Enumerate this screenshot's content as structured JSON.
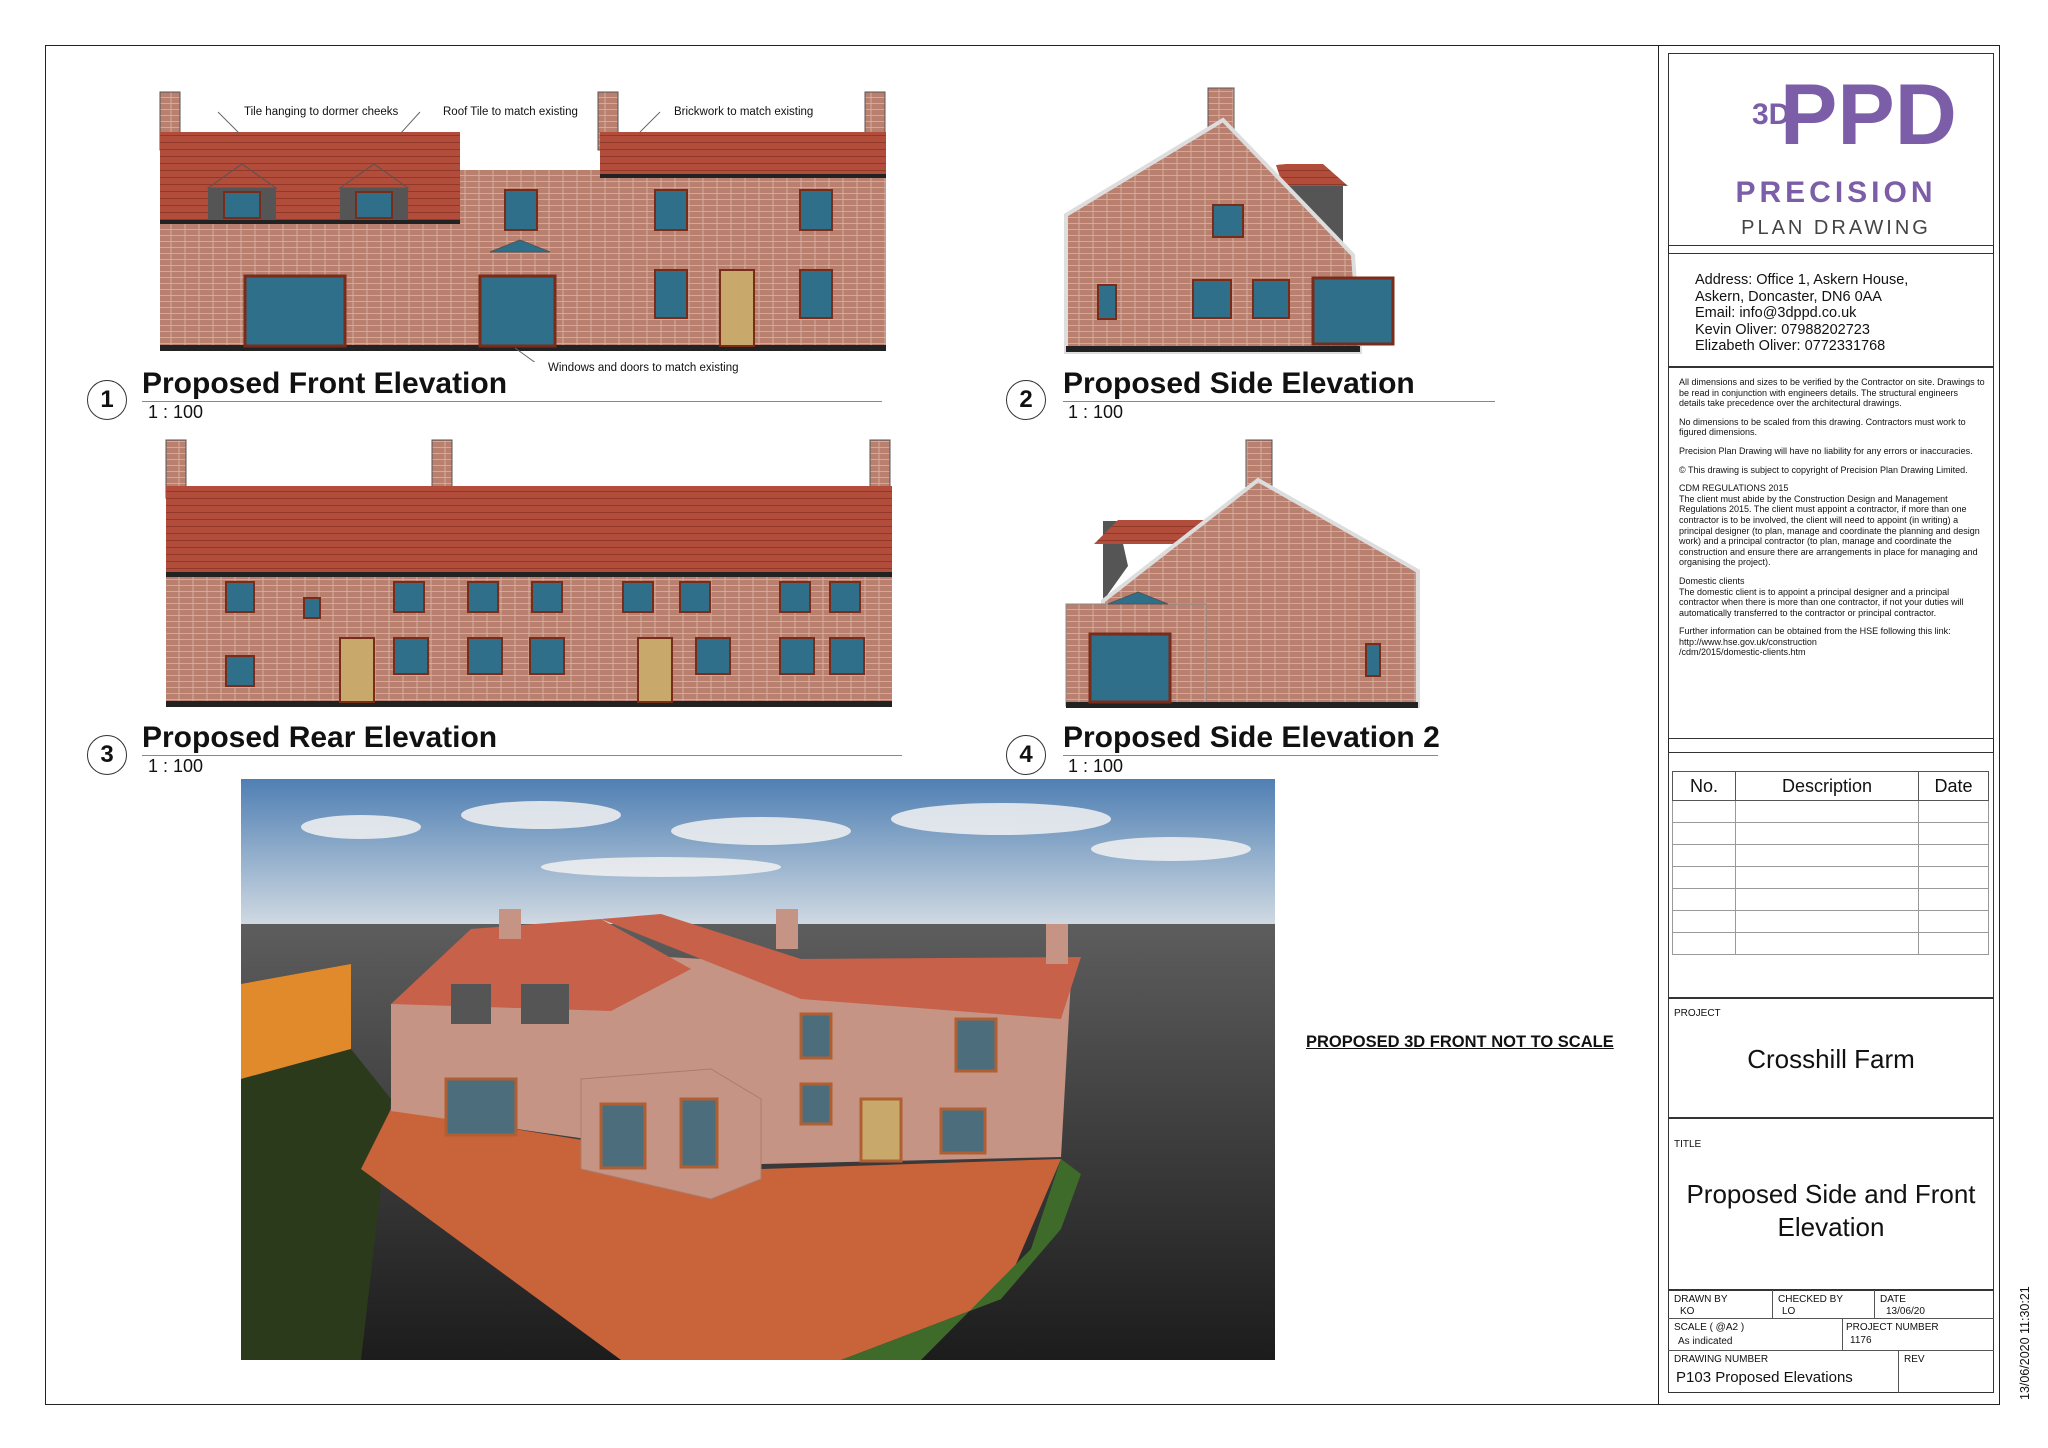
{
  "annotations": {
    "tile_hanging": "Tile hanging to dormer cheeks",
    "roof_tile": "Roof Tile to match existing",
    "brickwork": "Brickwork to match existing",
    "windows_doors": "Windows and doors to match existing"
  },
  "views": [
    {
      "number": "1",
      "title": "Proposed Front Elevation",
      "scale": "1 : 100"
    },
    {
      "number": "2",
      "title": "Proposed Side Elevation",
      "scale": "1 : 100"
    },
    {
      "number": "3",
      "title": "Proposed Rear Elevation",
      "scale": "1 : 100"
    },
    {
      "number": "4",
      "title": "Proposed Side Elevation 2",
      "scale": "1 : 100"
    }
  ],
  "render_caption": "PROPOSED 3D FRONT NOT TO SCALE",
  "logo": {
    "mark": "3D",
    "letters": "PPD",
    "name": "PRECISION",
    "sub": "PLAN DRAWING"
  },
  "address": {
    "line1": "Address: Office 1, Askern House,",
    "line2": "Askern, Doncaster, DN6 0AA",
    "email": "Email: info@3dppd.co.uk",
    "phone1": "Kevin Oliver: 07988202723",
    "phone2": "Elizabeth Oliver: 0772331768"
  },
  "notes": {
    "p1": "All dimensions and sizes to be verified by the Contractor on site. Drawings to be read in conjunction with engineers details. The structural engineers details take precedence over the architectural drawings.",
    "p2": "No dimensions to be scaled from this drawing. Contractors must work to figured dimensions.",
    "p3": "Precision Plan Drawing will have no liability for any errors or inaccuracies.",
    "p4": "© This drawing is subject to copyright of Precision Plan Drawing Limited.",
    "p5_head": "CDM REGULATIONS 2015",
    "p5": "The client must abide by the Construction Design and Management Regulations 2015. The client must appoint a contractor, if more than one contractor is to be involved, the client will need to appoint (in writing) a principal designer (to plan, manage and coordinate the planning and design work) and a principal contractor (to plan, manage and coordinate the construction and ensure there are arrangements in place for managing and organising the project).",
    "p6_head": "Domestic clients",
    "p6": "The domestic client is to appoint a principal designer and a principal contractor when there is more than one contractor, if not your duties will automatically transferred to the contractor or principal contractor.",
    "p7": "Further information can be obtained from the HSE following this link:",
    "p7_link1": "http://www.hse.gov.uk/construction",
    "p7_link2": "/cdm/2015/domestic-clients.htm"
  },
  "revisions": {
    "headers": [
      "No.",
      "Description",
      "Date"
    ]
  },
  "project": {
    "label": "PROJECT",
    "value": "Crosshill Farm"
  },
  "title_block": {
    "label": "TITLE",
    "line1": "Proposed Side and Front",
    "line2": "Elevation"
  },
  "drawn_by": {
    "label": "DRAWN BY",
    "value": "KO"
  },
  "checked_by": {
    "label": "CHECKED BY",
    "value": "LO"
  },
  "date": {
    "label": "DATE",
    "value": "13/06/20"
  },
  "scale_field": {
    "label": "SCALE ( @A2 )",
    "value": "As indicated"
  },
  "project_number": {
    "label": "PROJECT NUMBER",
    "value": "1176"
  },
  "drawing_number": {
    "label": "DRAWING NUMBER",
    "value": "P103 Proposed Elevations"
  },
  "rev": {
    "label": "REV",
    "value": ""
  },
  "timestamp": "13/06/2020 11:30:21",
  "colors": {
    "brick": "#b8786a",
    "roof": "#b24a3a",
    "glass": "#2f6f8a",
    "frame": "#a8462e",
    "door": "#c9a86b",
    "logo_purple": "#7b5ea7"
  }
}
